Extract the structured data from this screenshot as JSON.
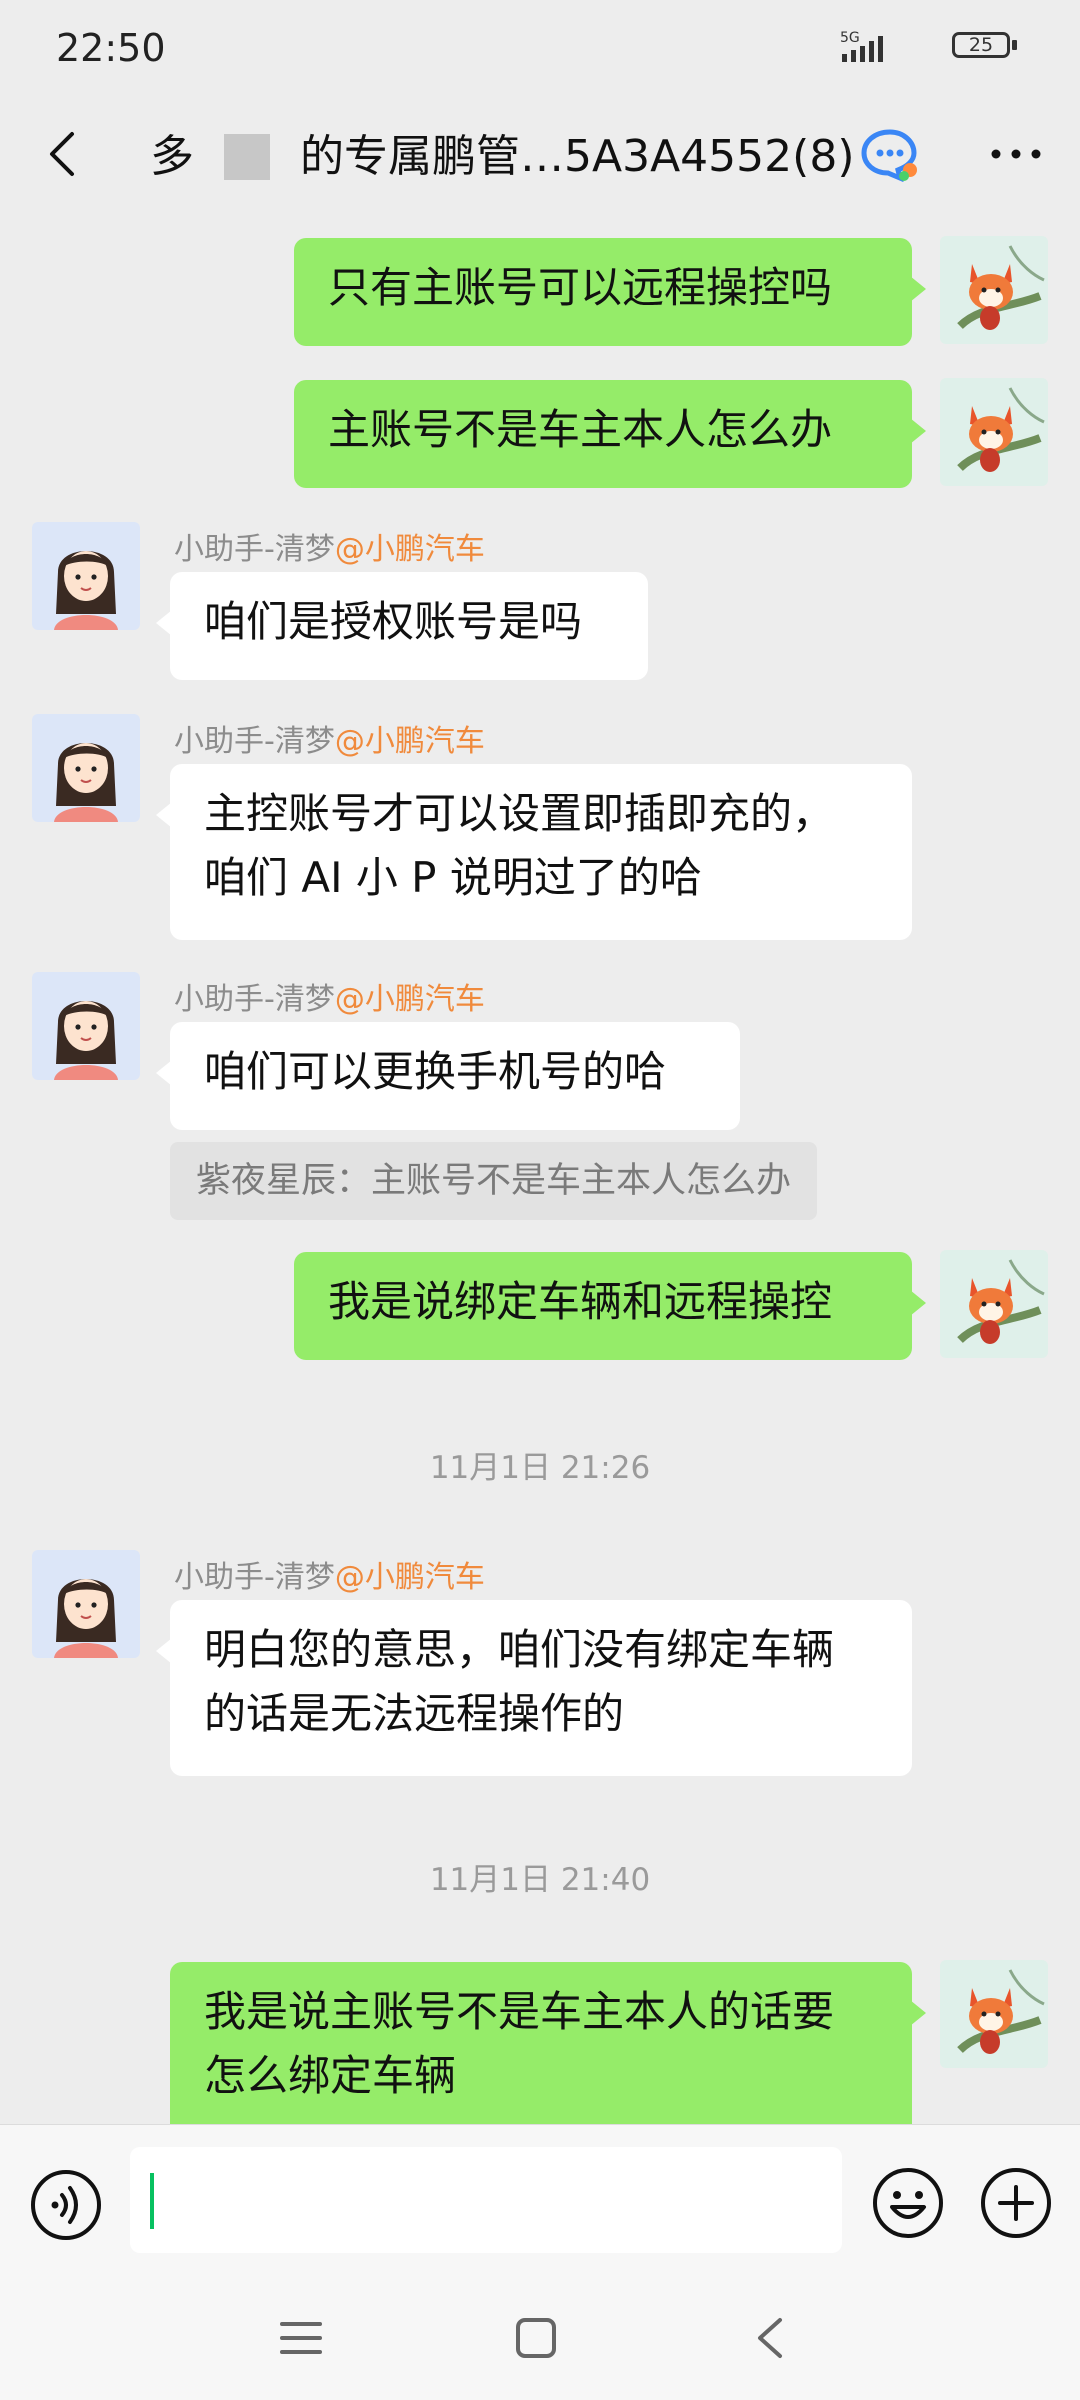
{
  "status_bar": {
    "time": "22:50",
    "network": "5G",
    "battery": "25"
  },
  "nav": {
    "title": "的专属鹏管…5A3A4552(8)",
    "title_prefix": "多"
  },
  "messages": [
    {
      "id": "m1",
      "from": "me",
      "text": "只有主账号可以远程操控吗"
    },
    {
      "id": "m2",
      "from": "me",
      "text": "主账号不是车主本人怎么办"
    },
    {
      "id": "m3",
      "from": "them",
      "sender": "小助手-清梦",
      "org": "@小鹏汽车",
      "text": "咱们是授权账号是吗"
    },
    {
      "id": "m4",
      "from": "them",
      "sender": "小助手-清梦",
      "org": "@小鹏汽车",
      "lines": [
        "主控账号才可以设置即插即充的，",
        "咱们 AI 小 P 说明过了的哈"
      ]
    },
    {
      "id": "m5",
      "from": "them",
      "sender": "小助手-清梦",
      "org": "@小鹏汽车",
      "text": "咱们可以更换手机号的哈",
      "quote": "紫夜星辰：主账号不是车主本人怎么办"
    },
    {
      "id": "m6",
      "from": "me",
      "text": "我是说绑定车辆和远程操控"
    },
    {
      "id": "t1",
      "timestamp": "11月1日 21:26"
    },
    {
      "id": "m7",
      "from": "them",
      "sender": "小助手-清梦",
      "org": "@小鹏汽车",
      "lines": [
        "明白您的意思，咱们没有绑定车辆",
        "的话是无法远程操作的"
      ]
    },
    {
      "id": "t2",
      "timestamp": "11月1日 21:40"
    },
    {
      "id": "m8",
      "from": "me",
      "lines": [
        "我是说主账号不是车主本人的话要",
        "怎么绑定车辆"
      ]
    }
  ],
  "input": {
    "value": "",
    "placeholder": ""
  },
  "icons": {
    "back": "chevron-left-icon",
    "more": "more-dots-icon",
    "chatbot": "chat-bubble-icon",
    "voice": "voice-icon",
    "emoji": "emoji-icon",
    "plus": "plus-icon"
  },
  "colors": {
    "my_bubble": "#95ec69",
    "their_bubble": "#ffffff",
    "org_label": "#f08a3c",
    "background": "#ededed",
    "cursor": "#07c160"
  }
}
